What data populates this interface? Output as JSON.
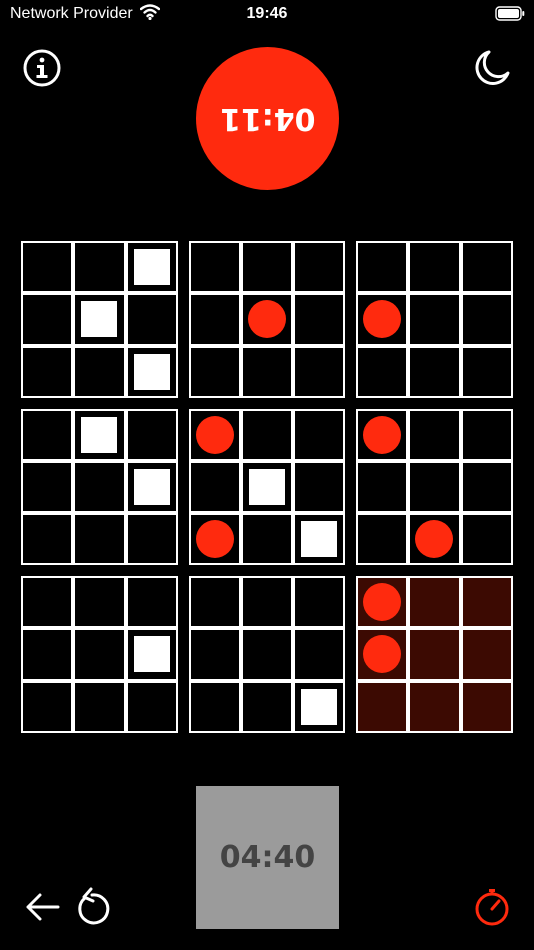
{
  "status_bar": {
    "carrier": "Network Provider",
    "time": "19:46"
  },
  "icons": {
    "info": "info-icon",
    "theme": "moon-icon",
    "back": "back-arrow-icon",
    "undo": "undo-icon",
    "timer_settings": "stopwatch-icon"
  },
  "timers": {
    "opponent": "04:11",
    "player": "04:40"
  },
  "colors": {
    "background": "#000000",
    "opponent_piece": "#ff2a0e",
    "player_piece": "#ffffff",
    "active_block": "#3c0a02",
    "player_timer_bg": "#9b9b9b"
  },
  "board": {
    "active_block": 8,
    "blocks": [
      [
        null,
        null,
        "square",
        null,
        "square",
        null,
        null,
        null,
        "square"
      ],
      [
        null,
        null,
        null,
        null,
        "circle",
        null,
        null,
        null,
        null
      ],
      [
        null,
        null,
        null,
        "circle",
        null,
        null,
        null,
        null,
        null
      ],
      [
        null,
        "square",
        null,
        null,
        null,
        "square",
        null,
        null,
        null
      ],
      [
        "circle",
        null,
        null,
        null,
        "square",
        null,
        "circle",
        null,
        "square"
      ],
      [
        "circle",
        null,
        null,
        null,
        null,
        null,
        null,
        "circle",
        null
      ],
      [
        null,
        null,
        null,
        null,
        null,
        "square",
        null,
        null,
        null
      ],
      [
        null,
        null,
        null,
        null,
        null,
        null,
        null,
        null,
        "square"
      ],
      [
        "circle",
        null,
        null,
        "circle",
        null,
        null,
        null,
        null,
        null
      ]
    ]
  }
}
